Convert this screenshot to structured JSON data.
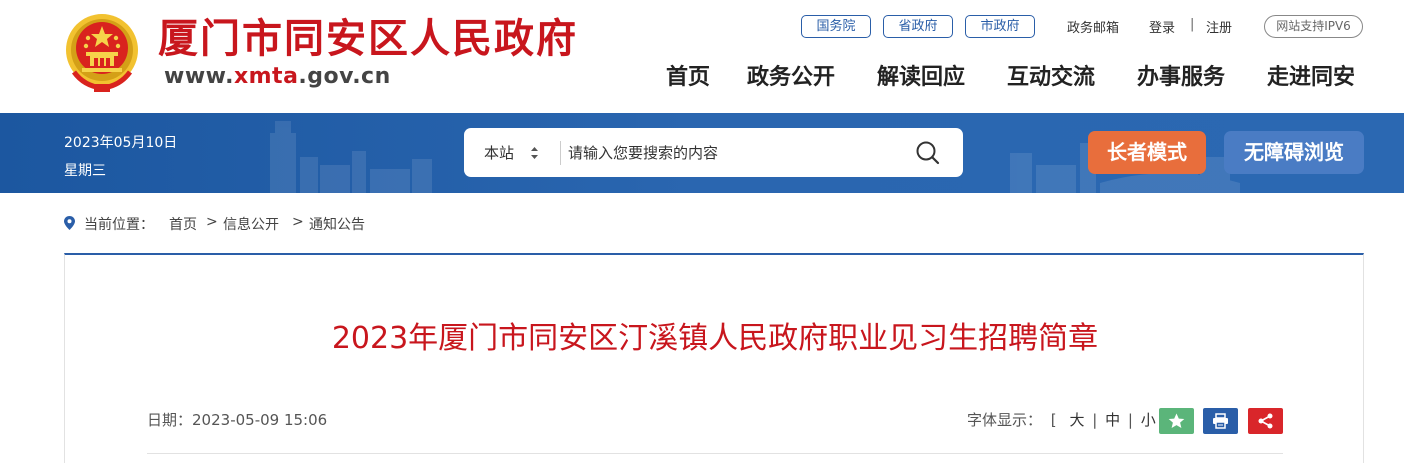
{
  "header": {
    "site_name": "厦门市同安区人民政府",
    "url_prefix": "www.",
    "url_highlight": "xmta",
    "url_suffix": ".gov.cn",
    "top_links": {
      "state_council": "国务院",
      "provincial_gov": "省政府",
      "city_gov": "市政府",
      "gov_email": "政务邮箱",
      "login": "登录",
      "separator": "|",
      "register": "注册",
      "ipv6": "网站支持IPV6"
    },
    "nav": [
      "首页",
      "政务公开",
      "解读回应",
      "互动交流",
      "办事服务",
      "走进同安"
    ]
  },
  "banner": {
    "date": "2023年05月10日",
    "weekday": "星期三",
    "search": {
      "scope": "本站",
      "placeholder": "请输入您要搜索的内容"
    },
    "elder_mode": "长者模式",
    "accessible": "无障碍浏览"
  },
  "breadcrumb": {
    "label": "当前位置：",
    "items": [
      "首页",
      "信息公开",
      "通知公告"
    ],
    "sep": ">"
  },
  "article": {
    "title": "2023年厦门市同安区汀溪镇人民政府职业见习生招聘简章",
    "date_label": "日期：",
    "date": "2023-05-09 15:06",
    "font_label": "字体显示：",
    "bracket_open": "[",
    "font_large": "大",
    "font_medium": "中",
    "font_small": "小",
    "bracket_close": "]",
    "pipe": "|"
  },
  "colors": {
    "brand_red": "#c8161d",
    "banner_blue": "#2a66b0",
    "elder_orange": "#e86e3c",
    "access_blue": "#4a7cc4",
    "favorite_green": "#5bb57a",
    "print_blue": "#2a5ea8",
    "share_red": "#d9262a"
  },
  "icons": {
    "search": "search-icon",
    "location": "location-pin-icon",
    "favorite": "star-icon",
    "print": "print-icon",
    "share": "share-icon",
    "emblem": "national-emblem-icon"
  }
}
